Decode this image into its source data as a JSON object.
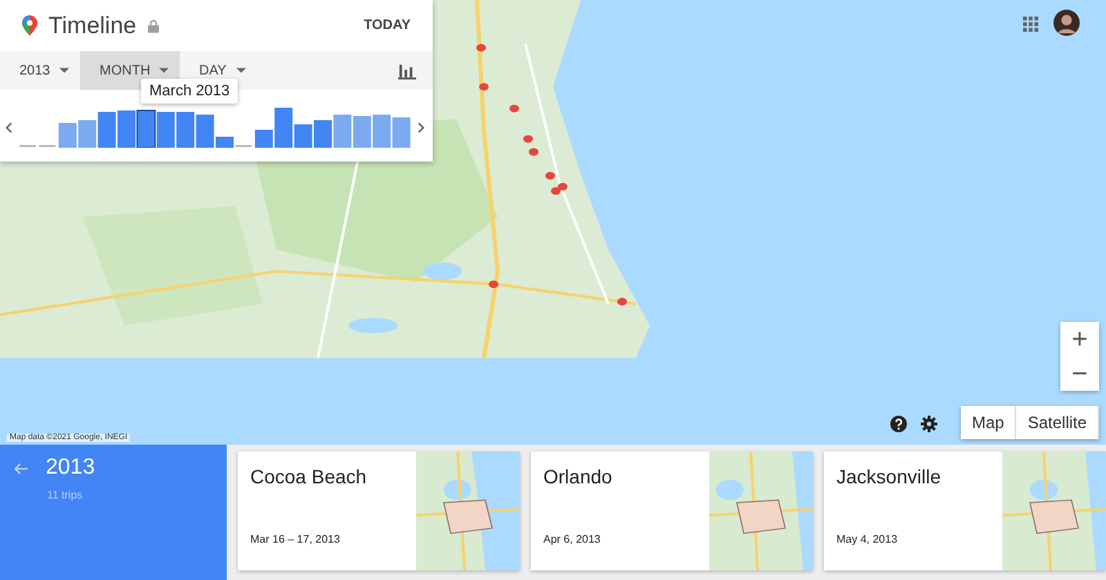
{
  "timeline": {
    "title": "Timeline",
    "today": "TODAY",
    "tooltip": "March 2013",
    "filters": [
      {
        "label": "2013",
        "selected": false
      },
      {
        "label": "MONTH",
        "selected": true
      },
      {
        "label": "DAY",
        "selected": false
      }
    ]
  },
  "map": {
    "attribution": "Map data ©2021 Google, INEGI",
    "zoom_in": "+",
    "zoom_out": "−",
    "map_types": [
      "Map",
      "Satellite"
    ]
  },
  "summary": {
    "year": "2013",
    "trips": "11 trips"
  },
  "trips": [
    {
      "place": "Cocoa Beach",
      "dates": "Mar 16 – 17, 2013"
    },
    {
      "place": "Orlando",
      "dates": "Apr 6, 2013"
    },
    {
      "place": "Jacksonville",
      "dates": "May 4, 2013"
    }
  ]
}
